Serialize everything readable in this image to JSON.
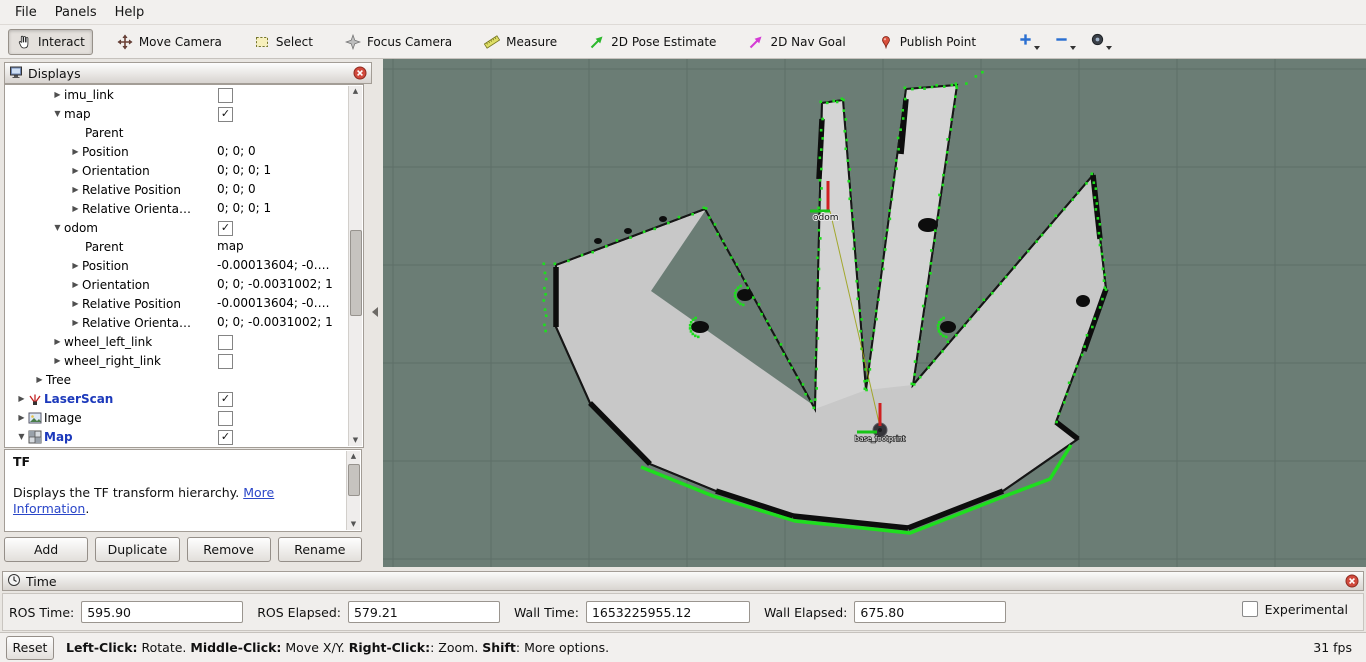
{
  "menu_bar": {
    "items": [
      "File",
      "Panels",
      "Help"
    ]
  },
  "toolbar": {
    "buttons": [
      {
        "label": "Interact",
        "icon": "hand-icon",
        "active": true
      },
      {
        "label": "Move Camera",
        "icon": "move-camera-icon",
        "active": false
      },
      {
        "label": "Select",
        "icon": "select-box-icon",
        "active": false
      },
      {
        "label": "Focus Camera",
        "icon": "focus-camera-icon",
        "active": false
      },
      {
        "label": "Measure",
        "icon": "measure-icon",
        "active": false
      },
      {
        "label": "2D Pose Estimate",
        "icon": "pose-estimate-icon",
        "active": false
      },
      {
        "label": "2D Nav Goal",
        "icon": "nav-goal-icon",
        "active": false
      },
      {
        "label": "Publish Point",
        "icon": "publish-point-icon",
        "active": false
      }
    ],
    "extra_tools": [
      {
        "name": "add-tool-button",
        "icon": "plus-icon"
      },
      {
        "name": "remove-tool-button",
        "icon": "minus-icon"
      },
      {
        "name": "tool-options-button",
        "icon": "eye-icon"
      }
    ]
  },
  "displays_panel": {
    "title": "Displays",
    "rows": [
      {
        "label": "imu_link",
        "arrow": "right",
        "checkbox": false,
        "indent": 2
      },
      {
        "label": "map",
        "arrow": "down",
        "checkbox": true,
        "indent": 2
      },
      {
        "label": "Parent",
        "indent": 3
      },
      {
        "label": "Position",
        "arrow": "right",
        "value": "0; 0; 0",
        "indent": 3
      },
      {
        "label": "Orientation",
        "arrow": "right",
        "value": "0; 0; 0; 1",
        "indent": 3
      },
      {
        "label": "Relative Position",
        "arrow": "right",
        "value": "0; 0; 0",
        "indent": 3
      },
      {
        "label": "Relative Orienta…",
        "arrow": "right",
        "value": "0; 0; 0; 1",
        "indent": 3
      },
      {
        "label": "odom",
        "arrow": "down",
        "checkbox": true,
        "indent": 2
      },
      {
        "label": "Parent",
        "value": "map",
        "indent": 3
      },
      {
        "label": "Position",
        "arrow": "right",
        "value": "-0.00013604; -0….",
        "indent": 3
      },
      {
        "label": "Orientation",
        "arrow": "right",
        "value": "0; 0; -0.0031002; 1",
        "indent": 3
      },
      {
        "label": "Relative Position",
        "arrow": "right",
        "value": "-0.00013604; -0….",
        "indent": 3
      },
      {
        "label": "Relative Orienta…",
        "arrow": "right",
        "value": "0; 0; -0.0031002; 1",
        "indent": 3
      },
      {
        "label": "wheel_left_link",
        "arrow": "right",
        "checkbox": false,
        "indent": 2
      },
      {
        "label": "wheel_right_link",
        "arrow": "right",
        "checkbox": false,
        "indent": 2
      },
      {
        "label": "Tree",
        "arrow": "right",
        "indent": 1
      },
      {
        "label": "LaserScan",
        "arrow": "right",
        "checkbox": true,
        "indent": 0,
        "icon": "laserscan-icon",
        "bold_blue": true
      },
      {
        "label": "Image",
        "arrow": "right",
        "checkbox": false,
        "indent": 0,
        "icon": "image-icon"
      },
      {
        "label": "Map",
        "arrow": "down",
        "checkbox": true,
        "indent": 0,
        "icon": "map-icon",
        "bold_blue": true
      }
    ],
    "description": {
      "title": "TF",
      "body": "Displays the TF transform hierarchy. ",
      "link": "More Information",
      "period": "."
    },
    "buttons": [
      "Add",
      "Duplicate",
      "Remove",
      "Rename"
    ]
  },
  "time_panel": {
    "title": "Time",
    "fields": [
      {
        "label": "ROS Time:",
        "value": "595.90",
        "width": 150
      },
      {
        "label": "ROS Elapsed:",
        "value": "579.21",
        "width": 140
      },
      {
        "label": "Wall Time:",
        "value": "1653225955.12",
        "width": 152
      },
      {
        "label": "Wall Elapsed:",
        "value": "675.80",
        "width": 140
      }
    ],
    "experimental_label": "Experimental"
  },
  "status_bar": {
    "reset_label": "Reset",
    "hint_parts": [
      {
        "bold": "Left-Click:",
        "text": " Rotate. "
      },
      {
        "bold": "Middle-Click:",
        "text": " Move X/Y. "
      },
      {
        "bold": "Right-Click:",
        "text": ": Zoom. "
      },
      {
        "bold": "Shift",
        "text": ": More options."
      }
    ],
    "fps": "31 fps"
  },
  "viewport": {
    "labels": {
      "odom_label": "odom",
      "base_label": "base_footprint"
    },
    "colors": {
      "background": "#6b7d75",
      "grid": "#5e6f68",
      "map_gray": "#c8c8c8",
      "map_gray_light": "#d4d4d4",
      "obstacle_black": "#0d0d0d",
      "laser_green": "#1ede1e",
      "axis_red": "#cf2020",
      "axis_green": "#17c517",
      "tf_yellow": "#9aa010"
    }
  }
}
